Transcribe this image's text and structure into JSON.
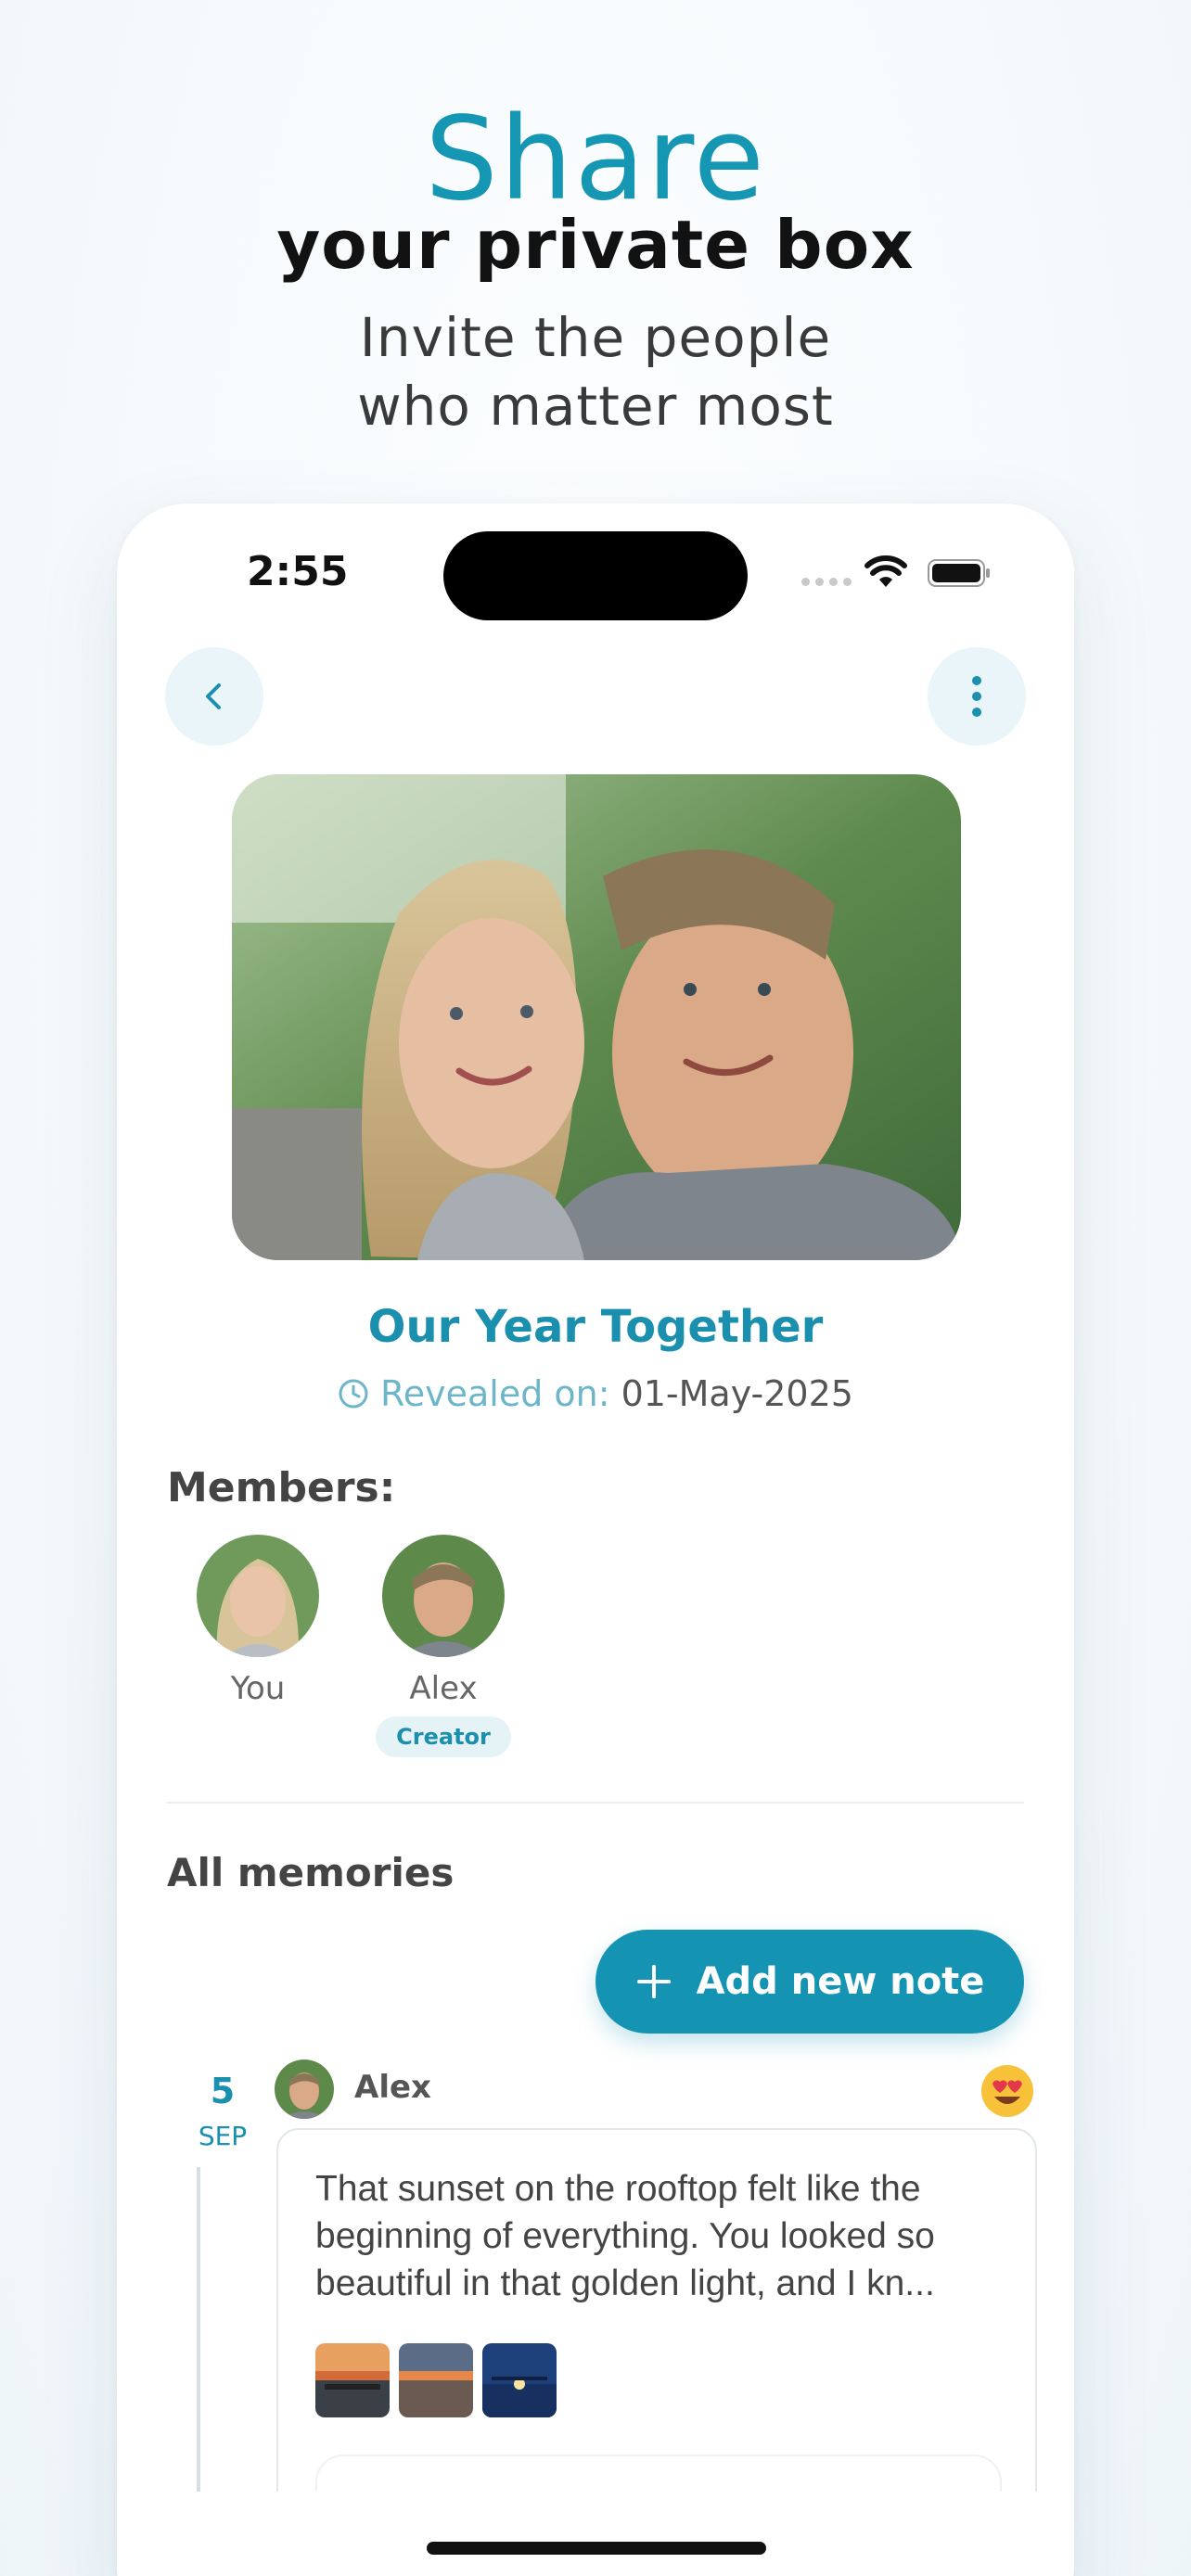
{
  "promo": {
    "title": "Share",
    "subtitle": "your private box",
    "line1": "Invite the people",
    "line2": "who matter most"
  },
  "status_bar": {
    "time": "2:55"
  },
  "nav": {
    "back_icon": "chevron-left-icon",
    "more_icon": "vertical-ellipsis-icon"
  },
  "box": {
    "title": "Our Year Together",
    "reveal_label": "Revealed on:",
    "reveal_date": "01-May-2025"
  },
  "members": {
    "label": "Members:",
    "items": [
      {
        "name": "You",
        "badge": ""
      },
      {
        "name": "Alex",
        "badge": "Creator"
      }
    ]
  },
  "memories": {
    "label": "All memories",
    "add_button_label": "Add new note",
    "notes": [
      {
        "day": "5",
        "month": "SEP",
        "author": "Alex",
        "reaction": "heart-eyes-emoji",
        "text": "That sunset on the rooftop felt like the beginning of everything. You looked so beautiful in that golden light, and I kn...",
        "photo_count": 3
      }
    ]
  },
  "colors": {
    "accent": "#1593b2",
    "accent_light": "#e9f5f8",
    "title_teal": "#1597b4"
  }
}
